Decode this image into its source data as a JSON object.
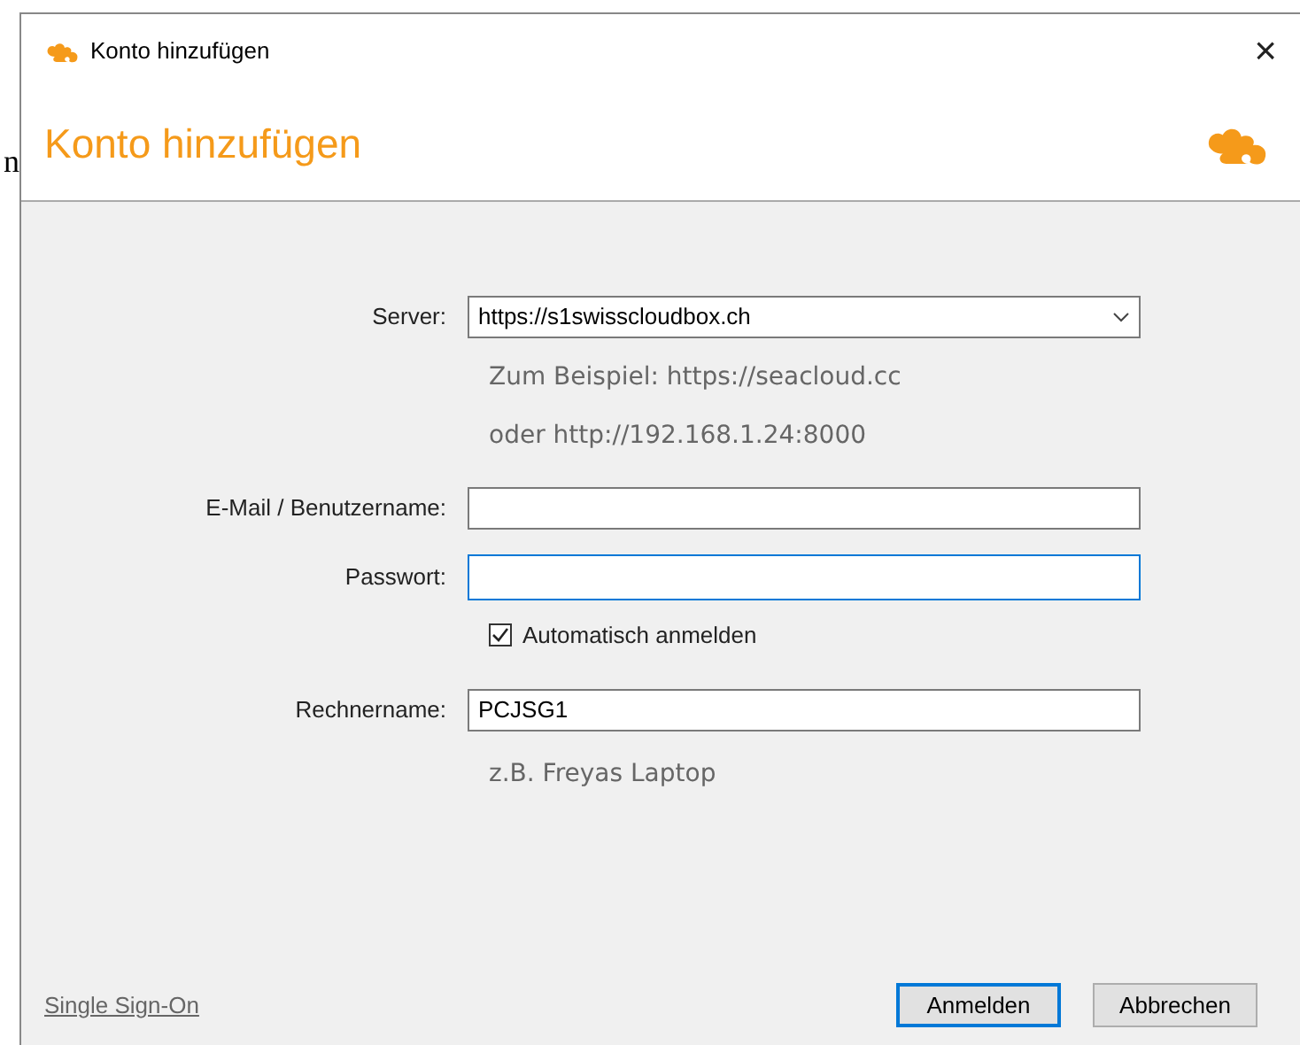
{
  "background_text": "n",
  "window": {
    "title": "Konto hinzufügen",
    "close": "×"
  },
  "header": {
    "title": "Konto hinzufügen"
  },
  "form": {
    "server": {
      "label": "Server:",
      "value": "https://s1swisscloudbox.ch",
      "hints": [
        "Zum Beispiel: https://seacloud.cc",
        "oder http://192.168.1.24:8000"
      ]
    },
    "email": {
      "label": "E-Mail / Benutzername:"
    },
    "password": {
      "label": "Passwort:",
      "focused": true
    },
    "auto_login": {
      "label": "Automatisch anmelden",
      "checked": true
    },
    "computer_name": {
      "label": "Rechnername:",
      "value": "PCJSG1",
      "hint": "z.B. Freyas Laptop"
    }
  },
  "footer": {
    "link": "Single Sign-On",
    "buttons": [
      {
        "label": "Anmelden",
        "default": true
      },
      {
        "label": "Abbrechen",
        "default": false
      }
    ]
  }
}
